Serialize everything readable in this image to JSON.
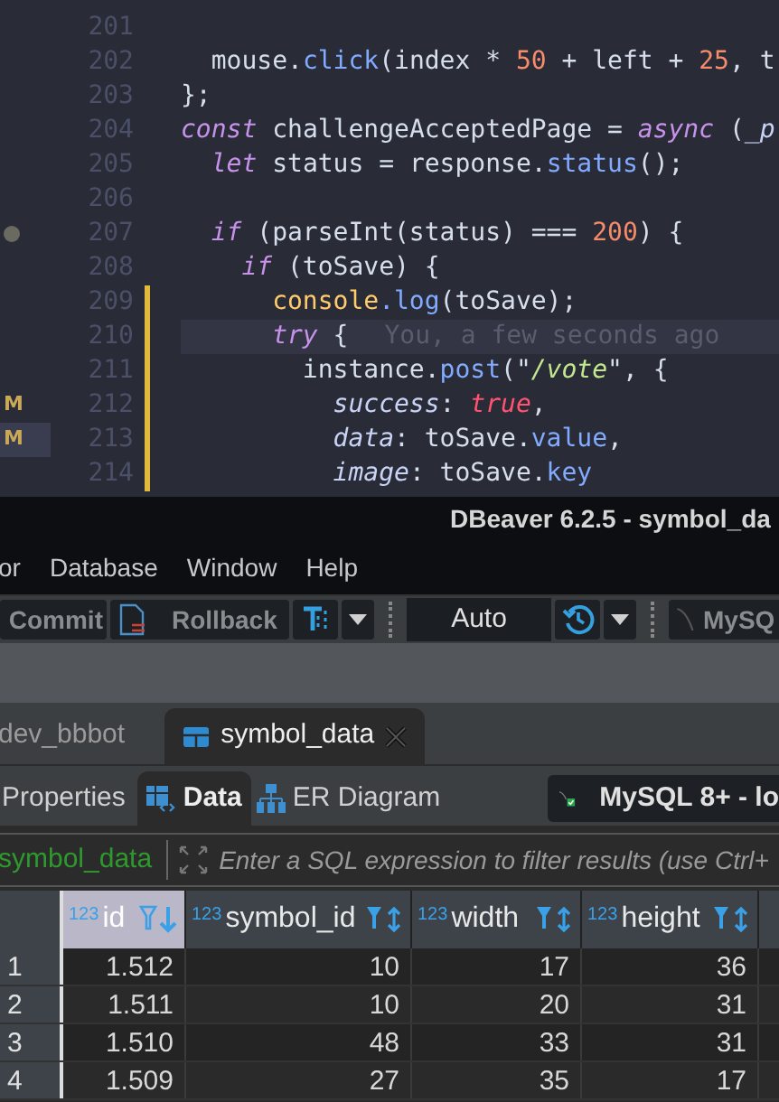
{
  "editor": {
    "lines": [
      {
        "number": "201",
        "modified": false,
        "current": false,
        "dot": false
      },
      {
        "number": "202",
        "modified": false,
        "current": false,
        "dot": false,
        "tokens": [
          {
            "kind": "plain",
            "text": "  mouse."
          },
          {
            "kind": "fn",
            "text": "click"
          },
          {
            "kind": "plain",
            "text": "(index * "
          },
          {
            "kind": "num",
            "text": "50"
          },
          {
            "kind": "plain",
            "text": " + left + "
          },
          {
            "kind": "num",
            "text": "25"
          },
          {
            "kind": "plain",
            "text": ", t"
          }
        ]
      },
      {
        "number": "203",
        "modified": false,
        "current": false,
        "dot": false,
        "tokens": [
          {
            "kind": "plain",
            "text": "};"
          }
        ]
      },
      {
        "number": "204",
        "modified": false,
        "current": false,
        "dot": false,
        "tokens": [
          {
            "kind": "kw",
            "text": "const"
          },
          {
            "kind": "plain",
            "text": " challengeAcceptedPage = "
          },
          {
            "kind": "kw",
            "text": "async"
          },
          {
            "kind": "plain",
            "text": " ("
          },
          {
            "kind": "prop",
            "text": "_p"
          }
        ]
      },
      {
        "number": "205",
        "modified": false,
        "current": false,
        "dot": false,
        "tokens": [
          {
            "kind": "kw",
            "text": "  let"
          },
          {
            "kind": "plain",
            "text": " status = response."
          },
          {
            "kind": "fn",
            "text": "status"
          },
          {
            "kind": "plain",
            "text": "();"
          }
        ]
      },
      {
        "number": "206",
        "modified": false,
        "current": false,
        "dot": false
      },
      {
        "number": "207",
        "modified": false,
        "current": false,
        "dot": true,
        "tokens": [
          {
            "kind": "kw",
            "text": "  if"
          },
          {
            "kind": "plain",
            "text": " (parseInt(status) === "
          },
          {
            "kind": "num",
            "text": "200"
          },
          {
            "kind": "plain",
            "text": ") {"
          }
        ]
      },
      {
        "number": "208",
        "modified": false,
        "current": false,
        "dot": false,
        "tokens": [
          {
            "kind": "kw",
            "text": "    if"
          },
          {
            "kind": "plain",
            "text": " (toSave) {"
          }
        ]
      },
      {
        "number": "209",
        "modified": true,
        "current": false,
        "dot": false,
        "tokens": [
          {
            "kind": "obj",
            "text": "      console"
          },
          {
            "kind": "fn",
            "text": ".log"
          },
          {
            "kind": "plain",
            "text": "(toSave);"
          }
        ]
      },
      {
        "number": "210",
        "modified": true,
        "current": true,
        "dot": false,
        "tokens": [
          {
            "kind": "kw",
            "text": "      try"
          },
          {
            "kind": "plain",
            "text": " {"
          }
        ],
        "blame": "You, a few seconds ago"
      },
      {
        "number": "211",
        "modified": true,
        "current": false,
        "dot": false,
        "tokens": [
          {
            "kind": "plain",
            "text": "        instance."
          },
          {
            "kind": "fn",
            "text": "post"
          },
          {
            "kind": "plain",
            "text": "(\""
          },
          {
            "kind": "str",
            "text": "/vote"
          },
          {
            "kind": "plain",
            "text": "\", {"
          }
        ]
      },
      {
        "number": "212",
        "modified": true,
        "current": false,
        "dot": false,
        "tokens": [
          {
            "kind": "prop",
            "text": "          success"
          },
          {
            "kind": "plain",
            "text": ": "
          },
          {
            "kind": "bool",
            "text": "true"
          },
          {
            "kind": "plain",
            "text": ","
          }
        ],
        "badge": {
          "text": "M",
          "selected": false
        }
      },
      {
        "number": "213",
        "modified": true,
        "current": false,
        "dot": false,
        "tokens": [
          {
            "kind": "prop",
            "text": "          data"
          },
          {
            "kind": "plain",
            "text": ": toSave."
          },
          {
            "kind": "fn",
            "text": "value"
          },
          {
            "kind": "plain",
            "text": ","
          }
        ],
        "badge": {
          "text": "M",
          "selected": true
        }
      },
      {
        "number": "214",
        "modified": true,
        "current": false,
        "dot": false,
        "tokens": [
          {
            "kind": "prop",
            "text": "          image"
          },
          {
            "kind": "plain",
            "text": ": toSave."
          },
          {
            "kind": "fn",
            "text": "key"
          }
        ]
      }
    ]
  },
  "window": {
    "title": "DBeaver 6.2.5 - symbol_da"
  },
  "menu": [
    "or",
    "Database",
    "Window",
    "Help"
  ],
  "toolbar": [
    {
      "kind": "commit",
      "label": "Commit"
    },
    {
      "kind": "rollback",
      "label": "Rollback"
    },
    {
      "kind": "format"
    },
    {
      "kind": "dropdown"
    },
    {
      "kind": "separator"
    },
    {
      "kind": "mode",
      "label": "Auto"
    },
    {
      "kind": "history"
    },
    {
      "kind": "dropdown"
    },
    {
      "kind": "separator"
    },
    {
      "kind": "connection",
      "label": "MySQ"
    }
  ],
  "editor_tabs": [
    {
      "label": "dev_bbbot",
      "selected": false
    },
    {
      "label": "symbol_data",
      "selected": true
    }
  ],
  "view_tabs": [
    {
      "kind": "properties",
      "label": "Properties",
      "selected": false
    },
    {
      "kind": "data",
      "label": "Data",
      "selected": true
    },
    {
      "kind": "er",
      "label": "ER Diagram",
      "selected": false
    }
  ],
  "connection": "MySQL 8+ - lo",
  "filter": {
    "table": "symbol_data",
    "placeholder": "Enter a SQL expression to filter results (use Ctrl+"
  },
  "table": {
    "columns": [
      {
        "type": "123",
        "label": "id",
        "selected": true,
        "sorted": true
      },
      {
        "type": "123",
        "label": "symbol_id",
        "selected": false,
        "sorted": false
      },
      {
        "type": "123",
        "label": "width",
        "selected": false,
        "sorted": false
      },
      {
        "type": "123",
        "label": "height",
        "selected": false,
        "sorted": false
      }
    ],
    "rows": [
      {
        "number": "1",
        "cells": [
          "1.512",
          "10",
          "17",
          "36"
        ]
      },
      {
        "number": "2",
        "cells": [
          "1.511",
          "10",
          "20",
          "31"
        ]
      },
      {
        "number": "3",
        "cells": [
          "1.510",
          "48",
          "33",
          "31"
        ]
      },
      {
        "number": "4",
        "cells": [
          "1.509",
          "27",
          "35",
          "17"
        ]
      }
    ]
  }
}
